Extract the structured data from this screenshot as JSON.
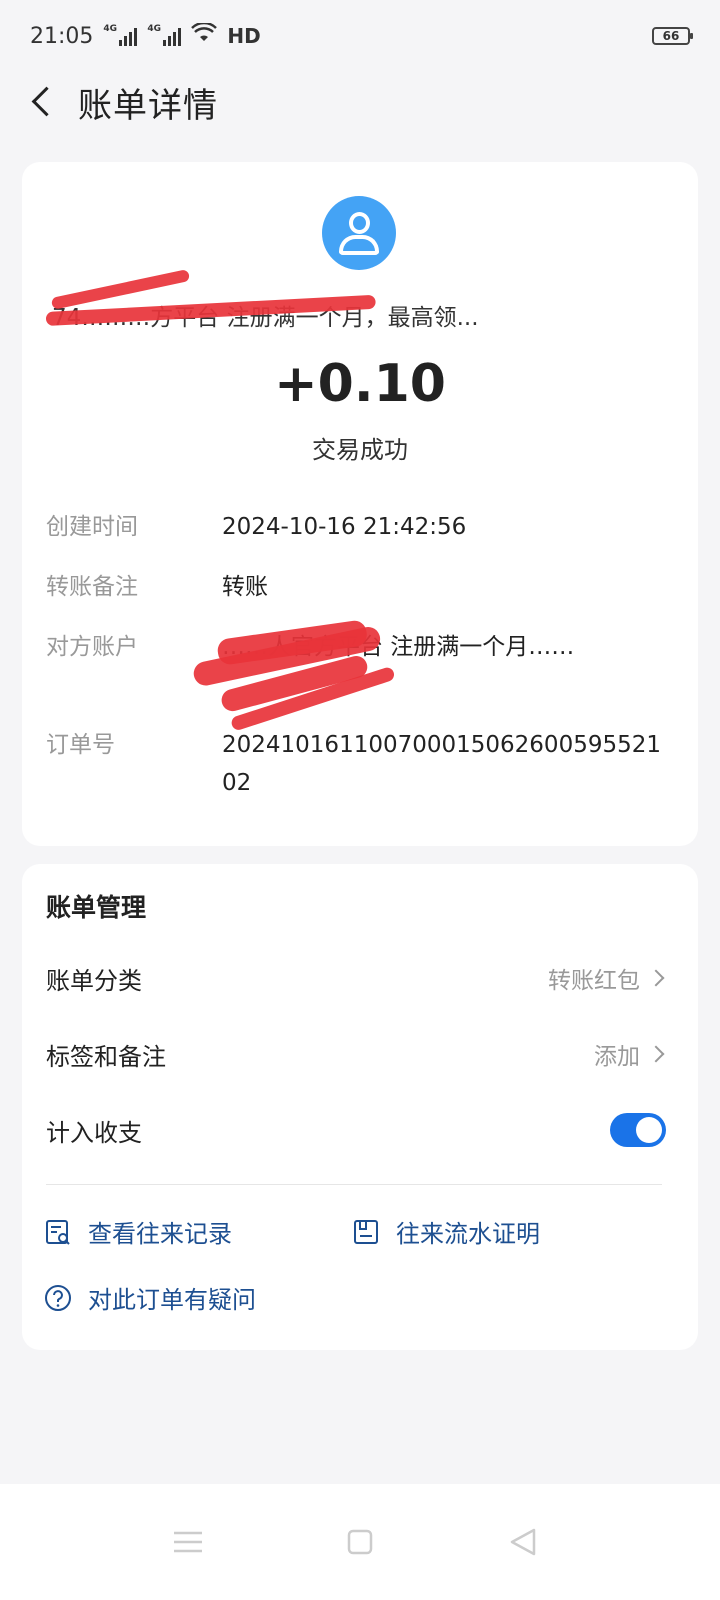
{
  "status_bar": {
    "time": "21:05",
    "signal1_tag": "4G",
    "signal2_tag": "4G",
    "hd": "HD",
    "battery": "66"
  },
  "header": {
    "title": "账单详情"
  },
  "transaction": {
    "counterparty_name": "74………方平台 注册满一个月，最高领...",
    "amount": "+0.10",
    "status": "交易成功"
  },
  "details": [
    {
      "label": "创建时间",
      "value": "2024-10-16 21:42:56"
    },
    {
      "label": "转账备注",
      "value": "转账"
    },
    {
      "label": "对方账户",
      "value": "……人官方平台 注册满一个月……"
    },
    {
      "label": "订单号",
      "value": "20241016110070001506260059552102"
    }
  ],
  "management": {
    "title": "账单管理",
    "category_label": "账单分类",
    "category_value": "转账红包",
    "tag_label": "标签和备注",
    "tag_value": "添加",
    "income_label": "计入收支",
    "income_on": true
  },
  "links": {
    "history": "查看往来记录",
    "statement": "往来流水证明",
    "question": "对此订单有疑问"
  },
  "colors": {
    "accent": "#1a73e8",
    "link": "#1d4f91",
    "avatar": "#44a3f5",
    "redaction": "#e8333a"
  },
  "icons": [
    "back-arrow-icon",
    "user-avatar-icon",
    "chevron-right-icon",
    "record-search-icon",
    "certificate-icon",
    "question-icon",
    "menu-icon",
    "home-icon",
    "back-icon"
  ]
}
